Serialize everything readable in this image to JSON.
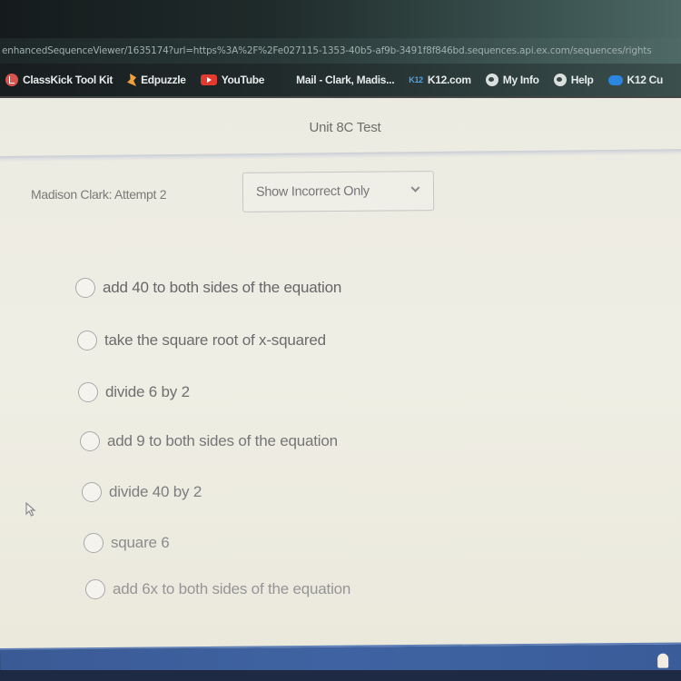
{
  "browser": {
    "url": "enhancedSequenceViewer/1635174?url=https%3A%2F%2Fe027115-1353-40b5-af9b-3491f8f846bd.sequences.api.ex.com/sequences/rights",
    "bookmarks": [
      {
        "label": "ClassKick Tool Kit",
        "icon": "classkick-icon"
      },
      {
        "label": "Edpuzzle",
        "icon": "edpuzzle-icon"
      },
      {
        "label": "YouTube",
        "icon": "youtube-icon"
      },
      {
        "label": "Mail - Clark, Madis...",
        "icon": "microsoft-icon"
      },
      {
        "label": "K12.com",
        "icon": "k12-icon"
      },
      {
        "label": "My Info",
        "icon": "globe-icon"
      },
      {
        "label": "Help",
        "icon": "globe-icon"
      },
      {
        "label": "K12 Cu",
        "icon": "cloud-icon"
      }
    ]
  },
  "page": {
    "title": "Unit 8C Test",
    "attempt_label": "Madison Clark: Attempt 2",
    "filter": {
      "selected": "Show Incorrect Only"
    }
  },
  "options": [
    {
      "label": "add 40 to both sides of the equation",
      "selected": false
    },
    {
      "label": "take the square root of x-squared",
      "selected": false
    },
    {
      "label": "divide 6 by 2",
      "selected": false
    },
    {
      "label": "add 9 to both sides of the equation",
      "selected": false
    },
    {
      "label": "divide 40 by 2",
      "selected": false
    },
    {
      "label": "square 6",
      "selected": false
    },
    {
      "label": "add 6x to both sides of the equation",
      "selected": false
    }
  ],
  "colors": {
    "page_bg": "#eeede4",
    "text": "#6b6b6b",
    "taskbar": "#3f63a2"
  }
}
